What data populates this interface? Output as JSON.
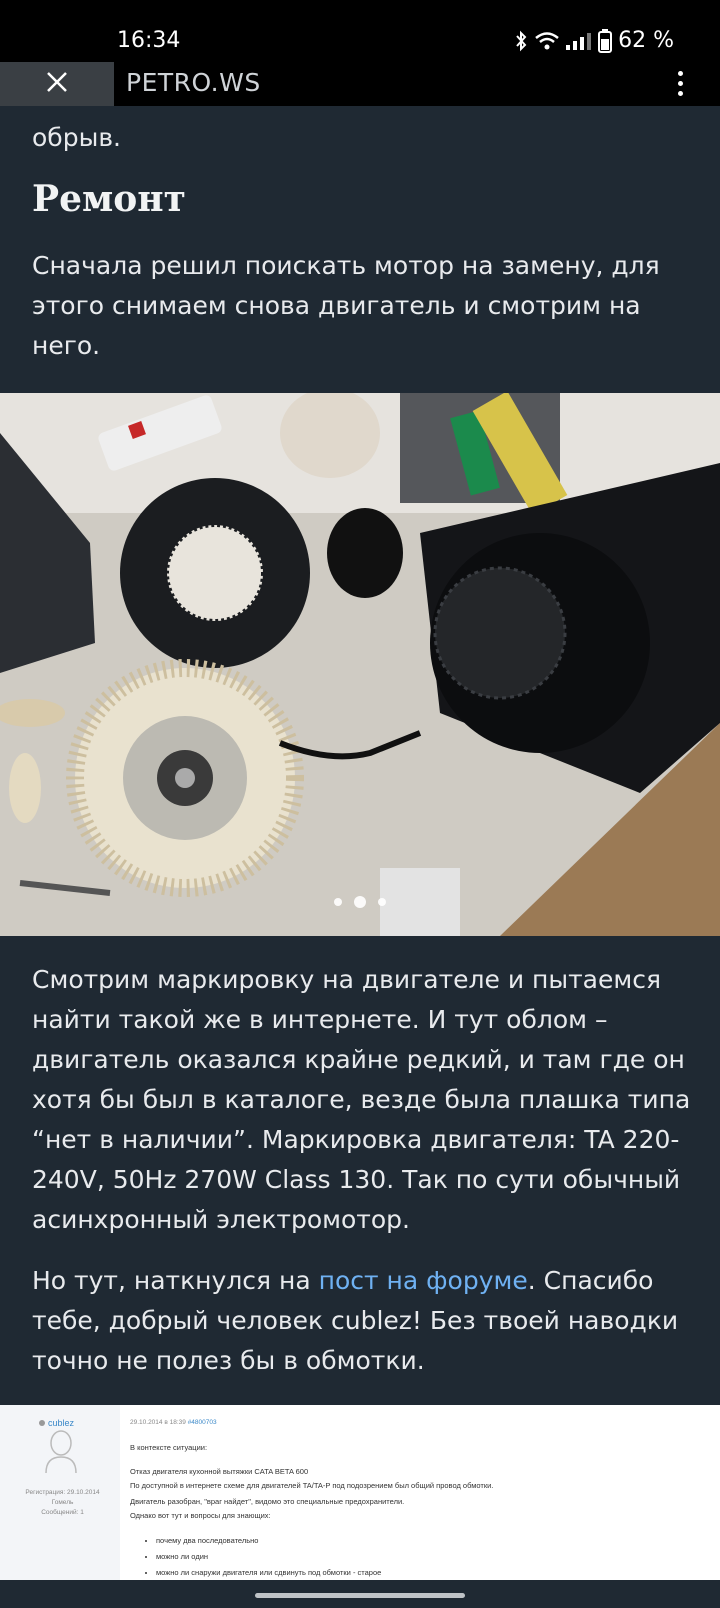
{
  "status": {
    "time": "16:34",
    "battery": "62 %"
  },
  "app_bar": {
    "site": "PETRO.WS"
  },
  "article": {
    "cut_text": "обрыв.",
    "heading": "Ремонт",
    "para1": "Сначала решил поискать мотор на замену, для этого снимаем снова двигатель и смотрим на него.",
    "carousel": {
      "current": 2,
      "total": 3
    },
    "para2": "Смотрим маркировку на двигателе и пытаемся найти такой же в интернете. И тут облом – двигатель оказался крайне редкий, и там где он хотя бы был в каталоге, везде была плашка типа “нет в наличии”. Маркировка двигателя: TA 220-240V, 50Hz 270W Class 130. Так по сути обычный асинхронный электромотор.",
    "para3_before": "Но тут, наткнулся на ",
    "para3_link": "пост на форуме",
    "para3_after": ". Спасибо тебе, добрый человек cublez! Без твоей наводки точно не полез бы в обмотки."
  },
  "forum": {
    "username": "cublez",
    "reg_line1": "Регистрация: 29.10.2014",
    "reg_line2": "Гомель",
    "reg_line3": "Сообщений: 1",
    "date": "29.10.2014 в 18:39",
    "post_id": "#4800703",
    "lines": [
      "В контексте ситуации:",
      "Отказ двигателя кухонной вытяжки CATA BETA 600",
      "По доступной в интернете схеме для двигателей TA/TA-P под подозрением был общий провод обмотки.",
      "Двигатель разобран, \"враг найдет\", видомо это специальные предохранители.",
      "Однако вот тут и вопросы для знающих:"
    ],
    "bullets": [
      "почему два последовательно",
      "можно ли один",
      "можно ли снаружи двигателя или сдвинуть под обмотки - старое"
    ]
  }
}
